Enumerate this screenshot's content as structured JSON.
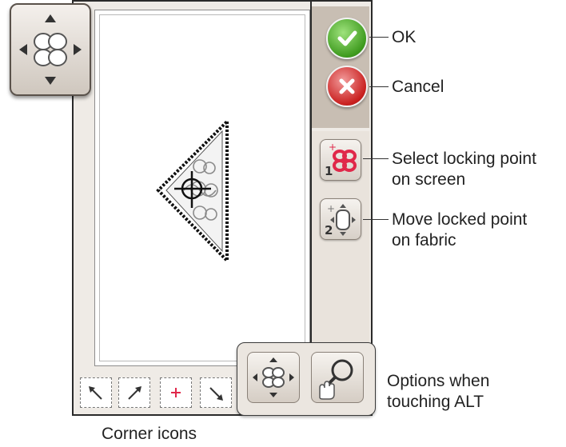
{
  "labels": {
    "ok": "OK",
    "cancel": "Cancel",
    "select_locking_point": [
      "Select locking point",
      "on screen"
    ],
    "move_locked_point": [
      "Move locked point",
      "on fabric"
    ],
    "alt_options": [
      "Options when",
      "touching ALT"
    ],
    "corner_icons": "Corner icons"
  },
  "icons": {
    "ok": "check-icon",
    "cancel": "close-icon",
    "select_locking_point": "select-locking-point-icon",
    "move_locked_point": "move-locked-point-icon",
    "move_arrows": "move-arrows-icon",
    "zoom_pan": "zoom-pan-icon",
    "corner_top_left": "corner-top-left-icon",
    "corner_top_right": "corner-top-right-icon",
    "corner_center": "corner-center-icon",
    "corner_bottom_right": "corner-bottom-right-icon"
  },
  "step_numbers": {
    "select": "1",
    "move": "2"
  },
  "colors": {
    "ok_green": "#3f9b1f",
    "cancel_red": "#c9201f",
    "accent_red": "#e0284a",
    "panel_top": "#c8beb3",
    "panel": "#e9e3dc"
  }
}
